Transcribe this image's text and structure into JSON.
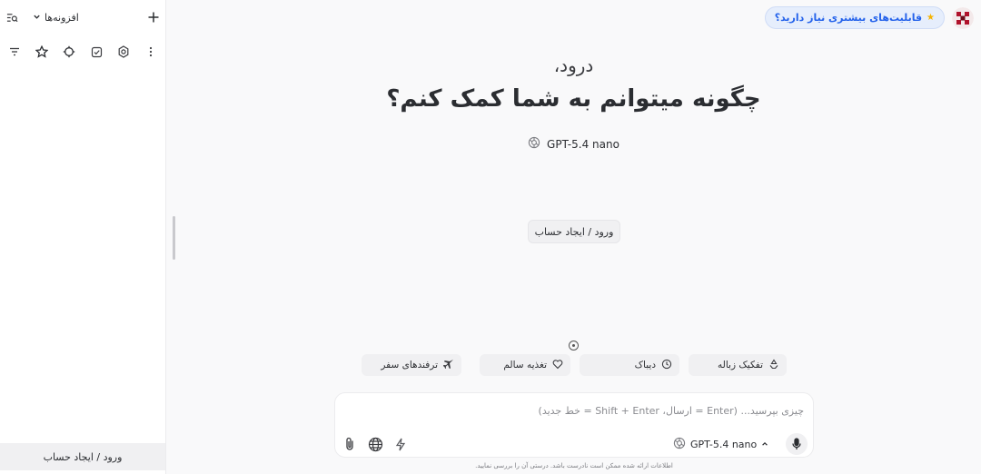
{
  "sidebar": {
    "plugins_label": "افزونه‌ها",
    "login_label": "ورود / ایجاد حساب",
    "tool_icons": [
      "more-vertical-icon",
      "gear-icon",
      "checkbox-icon",
      "crosshair-icon",
      "star-icon",
      "filter-icon"
    ]
  },
  "header": {
    "more_features_label": "قابلیت‌های بیشتری نیاز دارید؟"
  },
  "main": {
    "greeting_line1": "درود،",
    "greeting_line2": "چگونه میتوانم به شما کمک کنم؟",
    "model_name": "GPT-5.4 nano",
    "login_button": "ورود / ایجاد حساب"
  },
  "suggestions": [
    {
      "label": "تفکیک زباله",
      "icon": "recycle-icon"
    },
    {
      "label": "دیباک",
      "icon": "clock-icon"
    },
    {
      "label": "تغذیه سالم",
      "icon": "heart-icon"
    },
    {
      "label": "ترفندهای سفر",
      "icon": "airplane-icon"
    }
  ],
  "composer": {
    "placeholder": "چیزی بپرسید... (Enter = ارسال، Shift + Enter = خط جدید)",
    "model_name": "GPT-5.4 nano"
  },
  "disclaimer": "اطلاعات ارائه شده ممکن است نادرست باشد. درستی آن را بررسی نمایید.",
  "colors": {
    "accent_blue": "#2563eb",
    "chip_bg": "#f0f0f2",
    "background": "#f9f9fa"
  }
}
